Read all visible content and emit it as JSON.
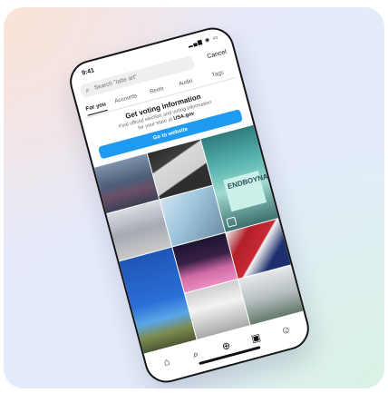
{
  "status_bar": {
    "time": "9:41",
    "icons": "▂▄▆ ◉ ▭"
  },
  "search": {
    "placeholder": "Search \"latte art\"",
    "cancel_label": "Cancel"
  },
  "tabs": [
    {
      "label": "For you"
    },
    {
      "label": "Accounts"
    },
    {
      "label": "Reels"
    },
    {
      "label": "Audio"
    },
    {
      "label": "Tags"
    }
  ],
  "voting_card": {
    "title": "Get voting information",
    "desc_line1": "Find official election and voting information",
    "desc_line2_prefix": "for your state at ",
    "desc_link": "USA.gov",
    "desc_line2_suffix": ".",
    "button_label": "Go to website"
  },
  "grid_images": [
    {
      "icon": "crowd-photo"
    },
    {
      "icon": "ballot-photo"
    },
    {
      "icon": "volunteer-photo",
      "sign_text": "ENDBOYNA",
      "reel": true
    },
    {
      "icon": "desk-photo"
    },
    {
      "icon": "envelope-photo"
    },
    {
      "icon": "sky-photo"
    },
    {
      "icon": "pink-photo"
    },
    {
      "icon": "flag-photo"
    },
    {
      "icon": "building-photo"
    },
    {
      "icon": "street-photo"
    }
  ],
  "bottom_nav": [
    {
      "icon": "home-icon",
      "glyph": "⌂"
    },
    {
      "icon": "search-icon",
      "glyph": "⌕"
    },
    {
      "icon": "add-icon",
      "glyph": "⊕"
    },
    {
      "icon": "reels-icon",
      "glyph": "▣"
    },
    {
      "icon": "profile-icon",
      "glyph": "☺"
    }
  ]
}
